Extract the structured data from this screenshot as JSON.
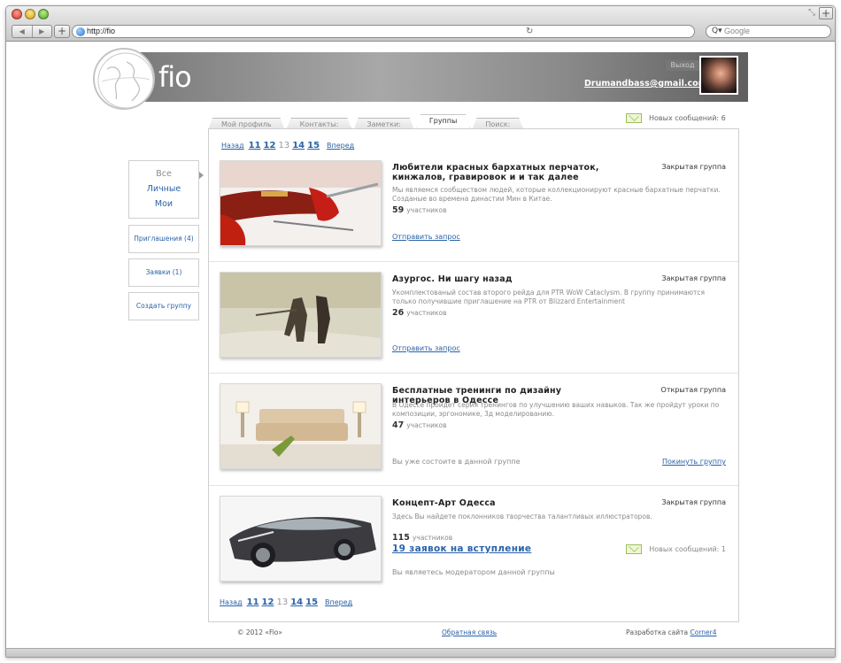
{
  "browser": {
    "address": "http://fio",
    "search_placeholder": "Google",
    "search_icon": "Q▾"
  },
  "header": {
    "logo_text": "fio",
    "exit_label": "Выход",
    "email": "Drumandbass@gmail.com"
  },
  "tabs": [
    {
      "label": "Мой профиль",
      "active": false
    },
    {
      "label": "Контакты:",
      "active": false
    },
    {
      "label": "Заметки:",
      "active": false
    },
    {
      "label": "Группы",
      "active": true
    },
    {
      "label": "Поиск:",
      "active": false
    }
  ],
  "top_messages": {
    "label": "Новых сообщений: 6"
  },
  "pager": {
    "prev": "Назад",
    "pages": [
      "11",
      "12",
      "13",
      "14",
      "15"
    ],
    "current": "13",
    "next": "Вперед"
  },
  "sidebar": {
    "filter_all": "Все",
    "filter_personal": "Личные",
    "filter_mine": "Мои",
    "invitations": "Приглашения (4)",
    "requests": "Заявки (1)",
    "create": "Создать группу"
  },
  "groups": [
    {
      "title": "Любители красных бархатных перчаток, кинжалов, гравировок и и так далее",
      "type": "Закрытая группа",
      "description": "Мы являемся сообществом людей, которые коллекционируют красные бархатные перчатки. Созданые во времена династии Мин в Китае.",
      "count": "59",
      "count_label": "участников",
      "action": "Отправить запрос"
    },
    {
      "title": "Азургос. Ни шагу назад",
      "type": "Закрытая группа",
      "description": "Укомплектованый состав второго рейда для PTR WoW Cataclysm. В группу принимаются только получившие приглашение на PTR от Blizzard Entertainment",
      "count": "26",
      "count_label": "участников",
      "action": "Отправить запрос"
    },
    {
      "title": "Бесплатные тренинги по дизайну интерьеров в Одессе",
      "type": "Открытая группа",
      "description": "В Одессе пройдет серия тренингов по улучшению ваших навыков. Так же пройдут уроки по композиции, эргономике, 3д моделированию.",
      "count": "47",
      "count_label": "участников",
      "note": "Вы уже состоите в данной группе",
      "leave": "Покинуть группу"
    },
    {
      "title": "Концепт-Арт Одесса",
      "type": "Закрытая группа",
      "description": "Здесь Вы найдете поклонников творчества талантливых иллюстраторов.",
      "count": "115",
      "count_label": "участников",
      "applications": "19 заявок на вступление",
      "messages": "Новых сообщений: 1",
      "note": "Вы являетесь модератором данной группы"
    }
  ],
  "footer": {
    "copyright": "© 2012 «Fio»",
    "feedback": "Обратная связь",
    "dev_label": "Разработка сайта",
    "dev_link": "Corner4"
  }
}
